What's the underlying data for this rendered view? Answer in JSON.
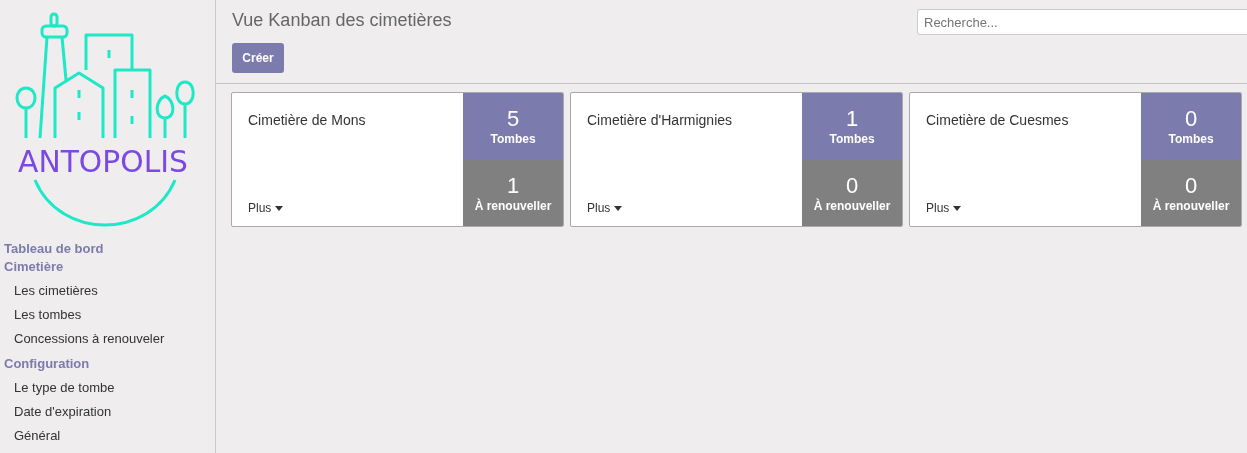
{
  "logo": {
    "text": "ANTOPOLIS"
  },
  "sidebar": {
    "sections": [
      {
        "title": "Tableau de bord"
      },
      {
        "title": "Cimetière",
        "items": [
          "Les cimetières",
          "Les tombes",
          "Concessions à renouveler"
        ]
      },
      {
        "title": "Configuration",
        "items": [
          "Le type de tombe",
          "Date d'expiration",
          "Général"
        ]
      }
    ]
  },
  "header": {
    "title": "Vue Kanban des cimetières",
    "create_button": "Créer",
    "search": {
      "placeholder": "Recherche..."
    }
  },
  "cards": [
    {
      "name": "Cimetière de Mons",
      "more": "Plus",
      "tombs": "5",
      "tombs_label": "Tombes",
      "renew": "1",
      "renew_label": "À renouveller"
    },
    {
      "name": "Cimetière d'Harmignies",
      "more": "Plus",
      "tombs": "1",
      "tombs_label": "Tombes",
      "renew": "0",
      "renew_label": "À renouveller"
    },
    {
      "name": "Cimetière de Cuesmes",
      "more": "Plus",
      "tombs": "0",
      "tombs_label": "Tombes",
      "renew": "0",
      "renew_label": "À renouveller"
    }
  ]
}
